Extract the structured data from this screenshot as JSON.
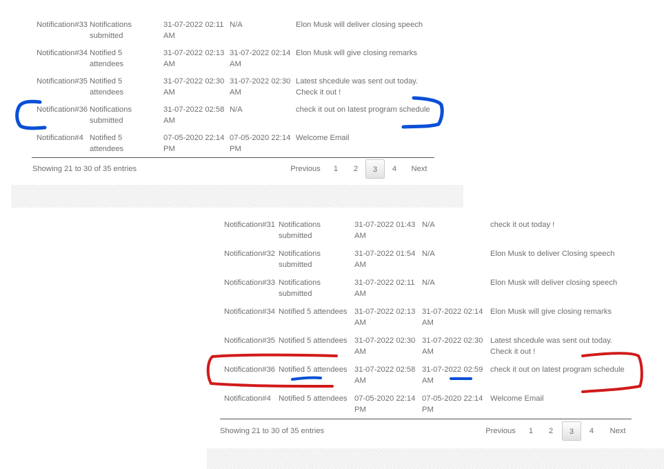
{
  "panels": [
    {
      "rows": [
        {
          "id": "Notification#33",
          "status": "Notifications submitted",
          "created": "31-07-2022 02:11 AM",
          "sent": "N/A",
          "message": "Elon Musk will deliver closing speech"
        },
        {
          "id": "Notification#34",
          "status": "Notified 5 attendees",
          "created": "31-07-2022 02:13 AM",
          "sent": "31-07-2022 02:14 AM",
          "message": "Elon Musk will give closing remarks"
        },
        {
          "id": "Notification#35",
          "status": "Notified 5 attendees",
          "created": "31-07-2022 02:30 AM",
          "sent": "31-07-2022 02:30 AM",
          "message": "Latest shcedule was sent out today. Check it out !"
        },
        {
          "id": "Notification#36",
          "status": "Notifications submitted",
          "created": "31-07-2022 02:58 AM",
          "sent": "N/A",
          "message": "check it out on latest program schedule"
        },
        {
          "id": "Notification#4",
          "status": "Notified 5 attendees",
          "created": "07-05-2020 22:14 PM",
          "sent": "07-05-2020 22:14 PM",
          "message": "Welcome Email"
        }
      ],
      "footer": {
        "showing": "Showing 21 to 30 of 35 entries"
      },
      "pagination": {
        "previous": "Previous",
        "pages": [
          "1",
          "2",
          "3",
          "4"
        ],
        "active": "3",
        "next": "Next"
      }
    },
    {
      "rows": [
        {
          "id": "Notification#31",
          "status": "Notifications submitted",
          "created": "31-07-2022 01:43 AM",
          "sent": "N/A",
          "message": "check it out today !"
        },
        {
          "id": "Notification#32",
          "status": "Notifications submitted",
          "created": "31-07-2022 01:54 AM",
          "sent": "N/A",
          "message": "Elon Musk to deliver Closing speech"
        },
        {
          "id": "Notification#33",
          "status": "Notifications submitted",
          "created": "31-07-2022 02:11 AM",
          "sent": "N/A",
          "message": "Elon Musk will deliver closing speech"
        },
        {
          "id": "Notification#34",
          "status": "Notified 5 attendees",
          "created": "31-07-2022 02:13 AM",
          "sent": "31-07-2022 02:14 AM",
          "message": "Elon Musk will give closing remarks"
        },
        {
          "id": "Notification#35",
          "status": "Notified 5 attendees",
          "created": "31-07-2022 02:30 AM",
          "sent": "31-07-2022 02:30 AM",
          "message": "Latest shcedule was sent out today. Check it out !"
        },
        {
          "id": "Notification#36",
          "status": "Notified 5 attendees",
          "created": "31-07-2022 02:58 AM",
          "sent": "31-07-2022 02:59 AM",
          "message": "check it out on latest program schedule"
        },
        {
          "id": "Notification#4",
          "status": "Notified 5 attendees",
          "created": "07-05-2020 22:14 PM",
          "sent": "07-05-2020 22:14 PM",
          "message": "Welcome Email"
        }
      ],
      "footer": {
        "showing": "Showing 21 to 30 of 35 entries"
      },
      "pagination": {
        "previous": "Previous",
        "pages": [
          "1",
          "2",
          "3",
          "4"
        ],
        "active": "3",
        "next": "Next"
      }
    }
  ],
  "annotations": {
    "blue": "#0a4fd6",
    "red": "#d11a1a"
  }
}
